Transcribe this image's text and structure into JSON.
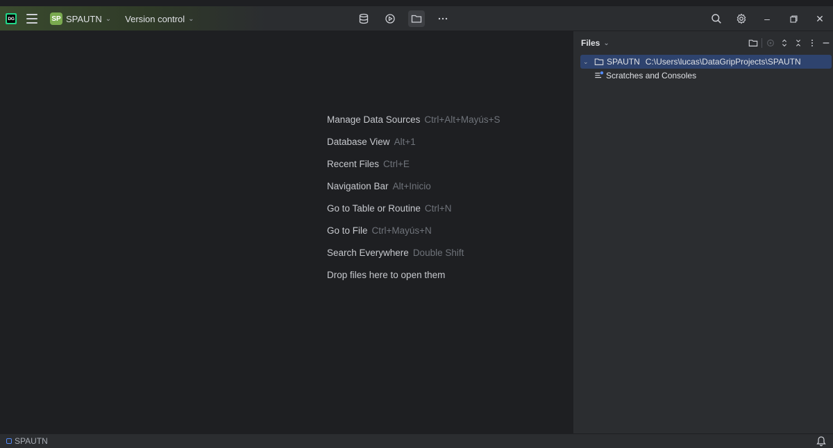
{
  "titlebar": {
    "app_logo_text": "DG",
    "project_badge": "SP",
    "project_name": "SPAUTN",
    "vcs_label": "Version control",
    "center_icons": [
      "database-icon",
      "run-icon",
      "folder-icon",
      "more-icon"
    ],
    "right_icons": [
      "search-icon",
      "settings-icon",
      "minimize-icon",
      "restore-icon",
      "close-icon"
    ]
  },
  "editor": {
    "hints": [
      {
        "label": "Manage Data Sources",
        "shortcut": "Ctrl+Alt+Mayús+S"
      },
      {
        "label": "Database View",
        "shortcut": "Alt+1"
      },
      {
        "label": "Recent Files",
        "shortcut": "Ctrl+E"
      },
      {
        "label": "Navigation Bar",
        "shortcut": "Alt+Inicio"
      },
      {
        "label": "Go to Table or Routine",
        "shortcut": "Ctrl+N"
      },
      {
        "label": "Go to File",
        "shortcut": "Ctrl+Mayús+N"
      },
      {
        "label": "Search Everywhere",
        "shortcut": "Double Shift"
      },
      {
        "label": "Drop files here to open them",
        "shortcut": ""
      }
    ]
  },
  "files_panel": {
    "title": "Files",
    "tree": [
      {
        "name": "SPAUTN",
        "path": "C:\\Users\\lucas\\DataGripProjects\\SPAUTN"
      },
      {
        "name": "Scratches and Consoles"
      }
    ]
  },
  "statusbar": {
    "project": "SPAUTN"
  },
  "colors": {
    "accent_selection": "#2e436e",
    "project_badge": "#7aaa4f",
    "status_box": "#548af7"
  }
}
